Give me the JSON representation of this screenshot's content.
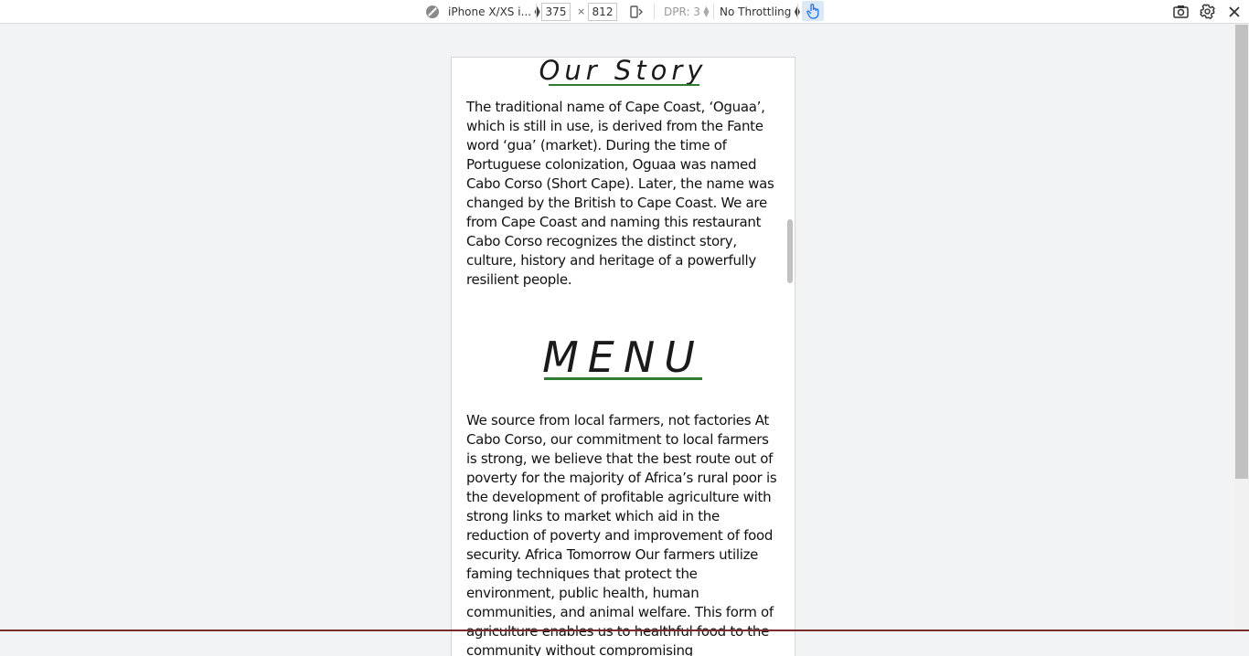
{
  "toolbar": {
    "device_select": "iPhone X/XS i...",
    "width_value": "375",
    "times_sign": "×",
    "height_value": "812",
    "dpr_label": "DPR: 3",
    "throttle_select": "No Throttling",
    "icons": [
      "no-sign-icon",
      "rotate-icon",
      "touch-icon",
      "screenshot-icon",
      "settings-gear-icon",
      "close-icon"
    ]
  },
  "page": {
    "story_title": "Our Story",
    "story_text": "The traditional name of Cape Coast, ‘Oguaa’, which is still in use, is derived from the Fante word ‘gua’ (market). During the time of Portuguese colonization, Oguaa was named Cabo Corso (Short Cape). Later, the name was changed by the British to Cape Coast. We are from Cape Coast and naming this restaurant Cabo Corso recognizes the distinct story, culture, history and heritage of a powerfully resilient people.",
    "menu_title": "MENU",
    "menu_text": "We source from local farmers, not factories At Cabo Corso, our commitment to local farmers is strong, we believe that the best route out of poverty for the majority of Africa’s rural poor is the development of profitable agriculture with strong links to market which aid in the reduction of poverty and improvement of food security. Africa Tomorrow Our farmers utilize faming techniques that protect the environment, public health, human communities, and animal welfare. This form of agriculture enables us to healthful food to the community without compromising"
  },
  "colors": {
    "accent_underline": "#2e7d32",
    "touch_active": "#1a73e8"
  }
}
